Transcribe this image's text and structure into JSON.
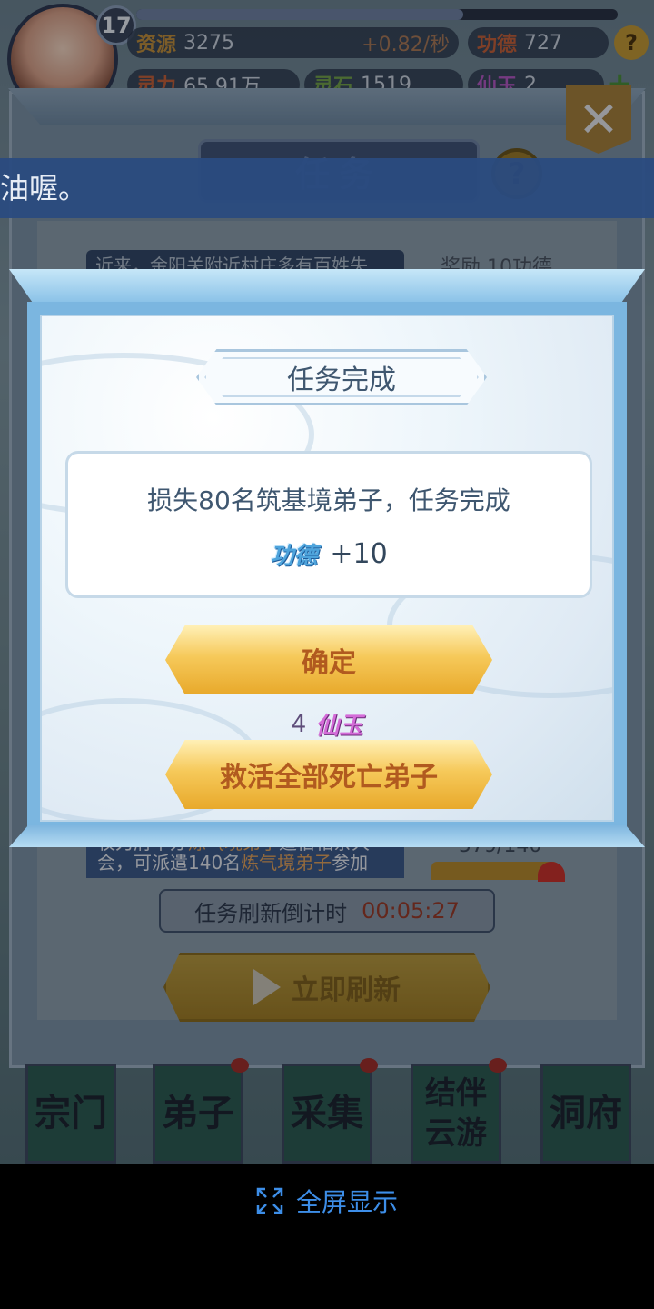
{
  "hud": {
    "level": "17",
    "xp_fraction": 0.68,
    "resource_rows": [
      {
        "label": "资源",
        "value": "3275",
        "rate": "+0.82/秒"
      },
      {
        "label": "功德",
        "value": "727"
      },
      {
        "label": "灵力",
        "value": "65.91万"
      },
      {
        "label": "灵石",
        "value": "1519"
      },
      {
        "label": "仙玉",
        "value": "2"
      }
    ]
  },
  "marquee": {
    "text": "油喔。"
  },
  "task_window": {
    "title": "任务",
    "top_item_text": "近来，金阳关附近村庄多有百姓失",
    "top_reward": "奖励 10功德",
    "bottom_item_text_1": "牧刀府举办",
    "bottom_item_hl": "炼气境弟子",
    "bottom_item_text_2": "道佰相亲大会，可派遣140名",
    "bottom_item_hl2": "炼气境弟子",
    "bottom_item_text_3": "参加",
    "bottom_progress": "579/140",
    "countdown_label": "任务刷新倒计时",
    "countdown_time": "00:05:27",
    "refresh_label": "立即刷新"
  },
  "bottom_nav": [
    "宗门",
    "弟子",
    "采集",
    "结伴云游",
    "洞府"
  ],
  "dialog": {
    "title": "任务完成",
    "result_text": "损失80名筑基境弟子，任务完成",
    "reward_icon_text": "功德",
    "reward_amount": "+10",
    "confirm_label": "确定",
    "revive_cost": "4",
    "revive_currency_text": "仙玉",
    "revive_label": "救活全部死亡弟子"
  },
  "system": {
    "fullscreen_label": "全屏显示"
  },
  "colors": {
    "accent": "#3d8ee8",
    "button_text": "#b15a1f",
    "dialog_title_text": "#3f5770"
  }
}
